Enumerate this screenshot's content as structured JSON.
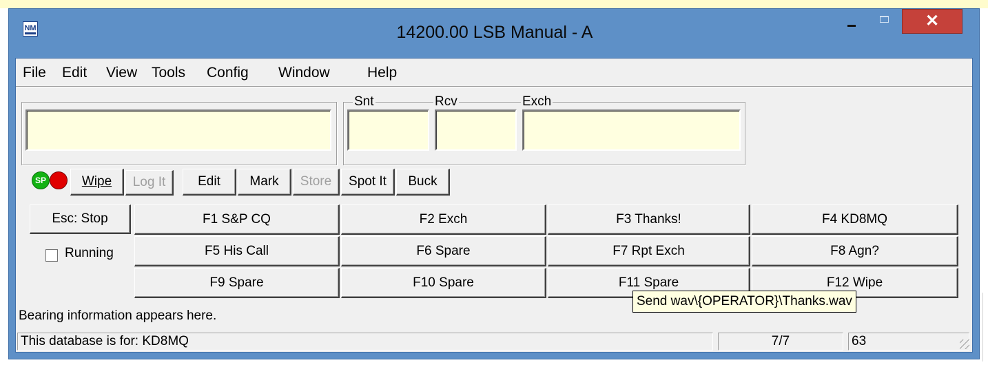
{
  "window": {
    "title": "14200.00 LSB Manual - A",
    "close_glyph": "✕",
    "icon_text": "NM"
  },
  "menu": [
    "File",
    "Edit",
    "View",
    "Tools",
    "Config",
    "Window",
    "Help"
  ],
  "entry": {
    "call_value": "",
    "snt_label": "Snt",
    "rcv_label": "Rcv",
    "exch_label": "Exch",
    "snt_value": "",
    "rcv_value": "",
    "exch_value": ""
  },
  "indicators": {
    "sp_label": "SP",
    "sp_color": "#13b213",
    "rec_color": "#e00000"
  },
  "action_buttons": {
    "wipe": "Wipe",
    "log_it": "Log It",
    "edit": "Edit",
    "mark": "Mark",
    "store": "Store",
    "spot_it": "Spot It",
    "buck": "Buck"
  },
  "esc_stop": "Esc: Stop",
  "running": {
    "label": "Running",
    "checked": false
  },
  "function_keys": [
    "F1 S&P CQ",
    "F2 Exch",
    "F3 Thanks!",
    "F4 KD8MQ",
    "F5 His Call",
    "F6 Spare",
    "F7 Rpt Exch",
    "F8 Agn?",
    "F9 Spare",
    "F10 Spare",
    "F11 Spare",
    "F12 Wipe"
  ],
  "tooltip": "Send wav\\{OPERATOR}\\Thanks.wav",
  "bearing_info": "Bearing information appears here.",
  "status": {
    "database": "This database is for: KD8MQ",
    "count": "7/7",
    "number": "63"
  }
}
